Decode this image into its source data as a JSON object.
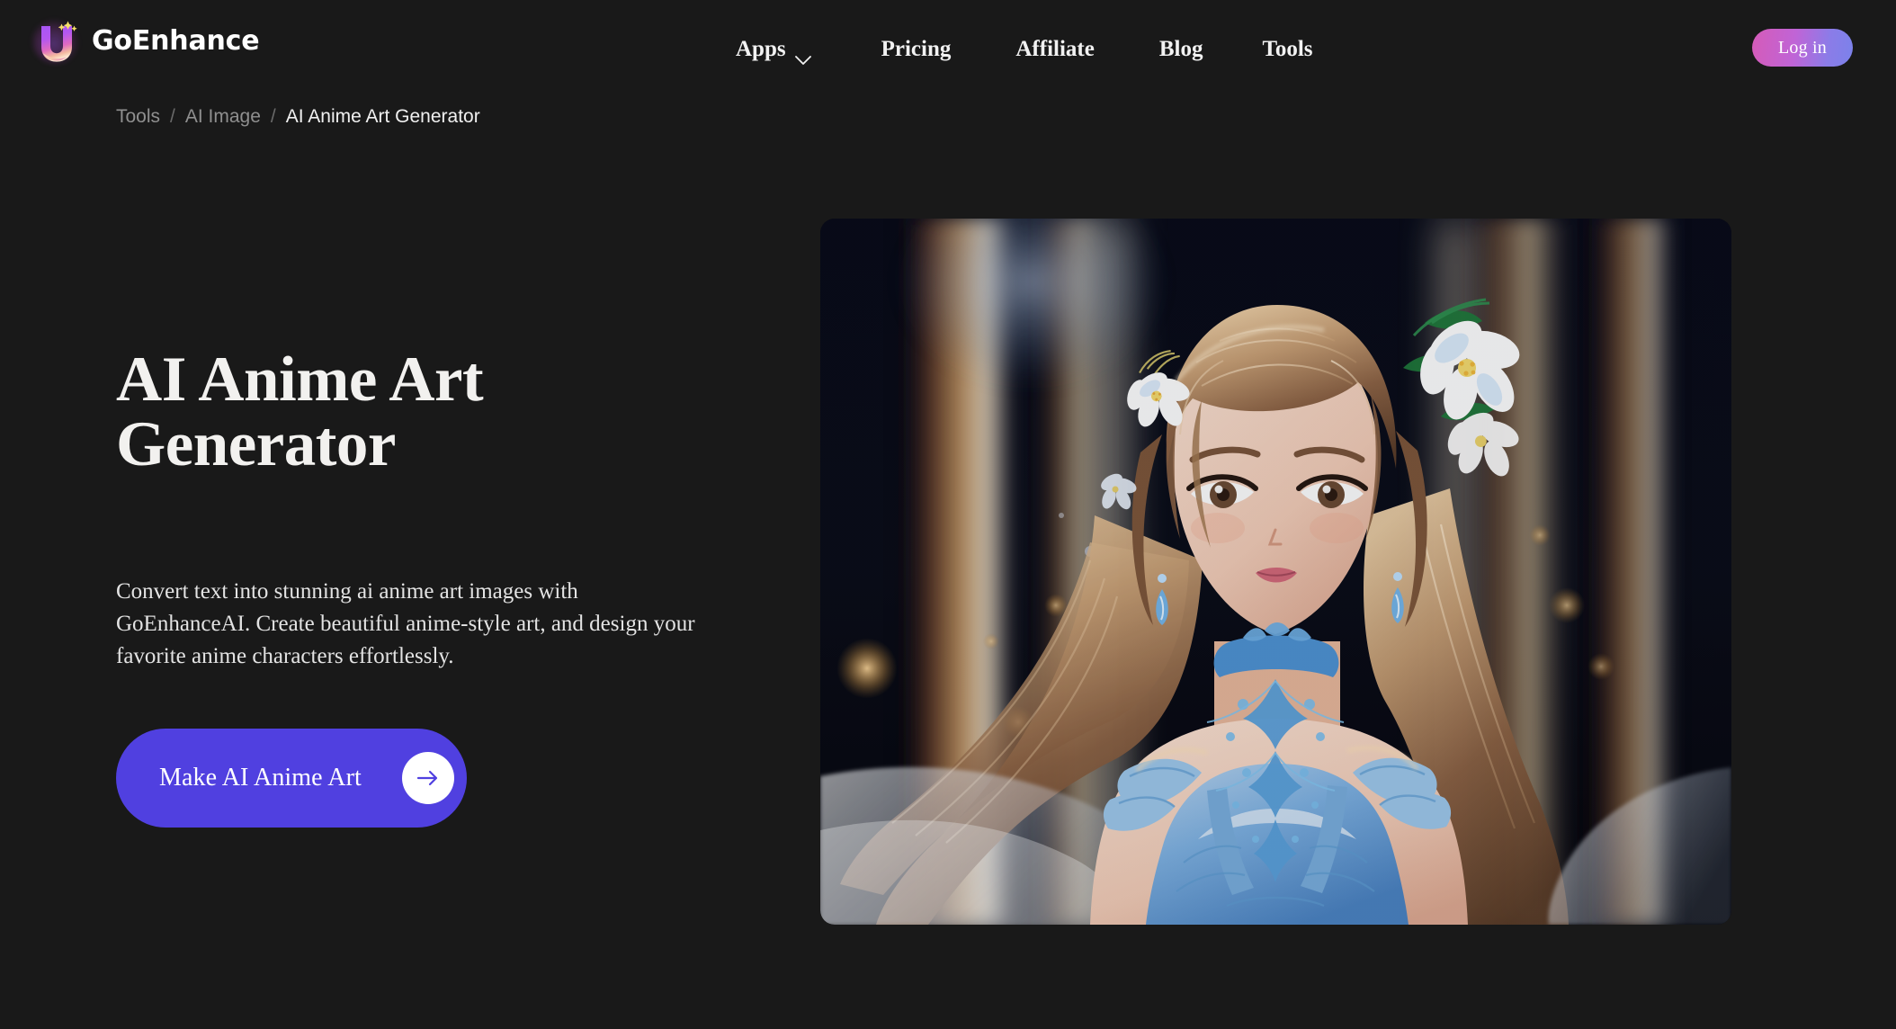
{
  "site": {
    "brand_name": "GoEnhance",
    "background_color": "#191919",
    "accent_color": "#5040e0"
  },
  "header": {
    "logo_icon": "goenhance-u-logo-icon",
    "nav": [
      {
        "label": "Apps",
        "has_dropdown": true,
        "icon": "chevron-down-icon"
      },
      {
        "label": "Pricing",
        "has_dropdown": false
      },
      {
        "label": "Affiliate",
        "has_dropdown": false
      },
      {
        "label": "Blog",
        "has_dropdown": false
      },
      {
        "label": "Tools",
        "has_dropdown": false
      }
    ],
    "login_label": "Log in",
    "login_gradient_from": "#d55bb8",
    "login_gradient_to": "#7b82ea"
  },
  "breadcrumb": {
    "items": [
      {
        "label": "Tools",
        "current": false
      },
      {
        "label": "AI Image",
        "current": false
      },
      {
        "label": "AI Anime Art Generator",
        "current": true
      }
    ],
    "separator": "/"
  },
  "hero": {
    "title_line_1": "AI Anime Art",
    "title_line_2": "Generator",
    "description": "Convert text into stunning ai anime art images with GoEnhanceAI. Create beautiful anime-style art, and design your favorite anime characters effortlessly.",
    "cta_label": "Make AI Anime Art",
    "cta_icon": "arrow-right-icon",
    "cta_color": "#5040e0",
    "image_alt": "Anime-style illustration of a girl with long light-brown hair, white flowers in her hair, blue teardrop earrings and an ornate blue lace dress, against a dark background with warm golden light columns and bokeh"
  }
}
